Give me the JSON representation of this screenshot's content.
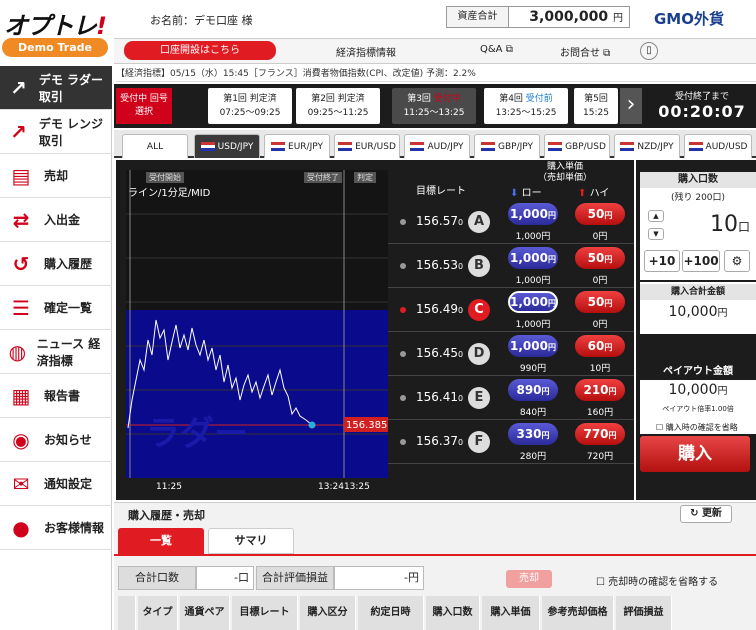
{
  "header": {
    "logo_main": "オプトレ",
    "logo_mark": "!",
    "demo_label": "Demo Trade",
    "account_label": "お名前：デモ口座 様",
    "asset_label": "資産合計",
    "asset_value": "3,000,000",
    "asset_unit": "円",
    "brand": "GMO外貨"
  },
  "topnav": {
    "open_account": "口座開設はこちら",
    "indicators": "経済指標情報",
    "qa": "Q&A",
    "contact": "お問合せ"
  },
  "news": "【経済指標】05/15（水）15:45［フランス］消費者物価指数(CPI、改定値) 予測：2.2%",
  "sidebar": [
    "デモ ラダー取引",
    "デモ レンジ取引",
    "売却",
    "入出金",
    "購入履歴",
    "確定一覧",
    "ニュース 経済指標",
    "報告書",
    "お知らせ",
    "通知設定",
    "お客様情報"
  ],
  "rounds": {
    "selected": "受付中 回号選択",
    "items": [
      {
        "name": "第1回",
        "status": "判定済",
        "time": "07:25〜09:25"
      },
      {
        "name": "第2回",
        "status": "判定済",
        "time": "09:25〜11:25"
      },
      {
        "name": "第3回",
        "status": "受付中",
        "time": "11:25〜13:25"
      },
      {
        "name": "第4回",
        "status": "受付前",
        "time": "13:25〜15:25"
      },
      {
        "name": "第5回",
        "status": "",
        "time": "15:25"
      }
    ],
    "end_label": "受付終了まで",
    "countdown": "00:20:07"
  },
  "pairs": [
    "ALL",
    "USD/JPY",
    "EUR/JPY",
    "EUR/USD",
    "AUD/JPY",
    "GBP/JPY",
    "GBP/USD",
    "NZD/JPY",
    "AUD/USD"
  ],
  "chart": {
    "title": "ライン/1分足/MID",
    "label_open": "受付開始",
    "label_close": "受付終了",
    "label_judge": "判定",
    "watermark": "ラダー",
    "price": "156.385",
    "time_start": "11:25",
    "time_end1": "13:24",
    "time_end2": "13:25"
  },
  "ladder": {
    "target_rate": "目標レート",
    "buy_price": "購入単価",
    "sell_price": "（売却単価）",
    "low": "ロー",
    "high": "ハイ",
    "rows": [
      {
        "rate": "156.57",
        "sub": "0",
        "letter": "A",
        "low": "1,000",
        "low_sell": "1,000円",
        "high": "50",
        "high_sell": "0円"
      },
      {
        "rate": "156.53",
        "sub": "0",
        "letter": "B",
        "low": "1,000",
        "low_sell": "1,000円",
        "high": "50",
        "high_sell": "0円"
      },
      {
        "rate": "156.49",
        "sub": "0",
        "letter": "C",
        "low": "1,000",
        "low_sell": "1,000円",
        "high": "50",
        "high_sell": "0円"
      },
      {
        "rate": "156.45",
        "sub": "0",
        "letter": "D",
        "low": "1,000",
        "low_sell": "990円",
        "high": "60",
        "high_sell": "10円"
      },
      {
        "rate": "156.41",
        "sub": "0",
        "letter": "E",
        "low": "890",
        "low_sell": "840円",
        "high": "210",
        "high_sell": "160円"
      },
      {
        "rate": "156.37",
        "sub": "0",
        "letter": "F",
        "low": "330",
        "low_sell": "280円",
        "high": "770",
        "high_sell": "720円"
      }
    ]
  },
  "right": {
    "qty_label": "購入口数",
    "remain": "(残り 200口)",
    "qty": "10",
    "qty_unit": "口",
    "plus10": "+10",
    "plus100": "+100",
    "total_label": "購入合計金額",
    "total": "10,000",
    "total_unit": "円",
    "payout_label": "ペイアウト金額",
    "payout": "10,000",
    "payout_unit": "円",
    "payout_note": "ペイアウト倍率1.00倍",
    "confirm": "購入時の確認を省略",
    "buy": "購入"
  },
  "bottom": {
    "title": "購入履歴・売却",
    "refresh": "更新",
    "tab_list": "一覧",
    "tab_summary": "サマリ",
    "total_qty_label": "合計口数",
    "total_qty": "-口",
    "total_eval_label": "合計評価損益",
    "total_eval": "-円",
    "sell_btn": "売却",
    "sell_confirm": "売却時の確認を省略する",
    "columns": [
      "タイプ",
      "通貨ペア",
      "目標レート",
      "購入区分",
      "約定日時",
      "購入口数",
      "購入単価",
      "参考売却価格",
      "評価損益"
    ]
  }
}
